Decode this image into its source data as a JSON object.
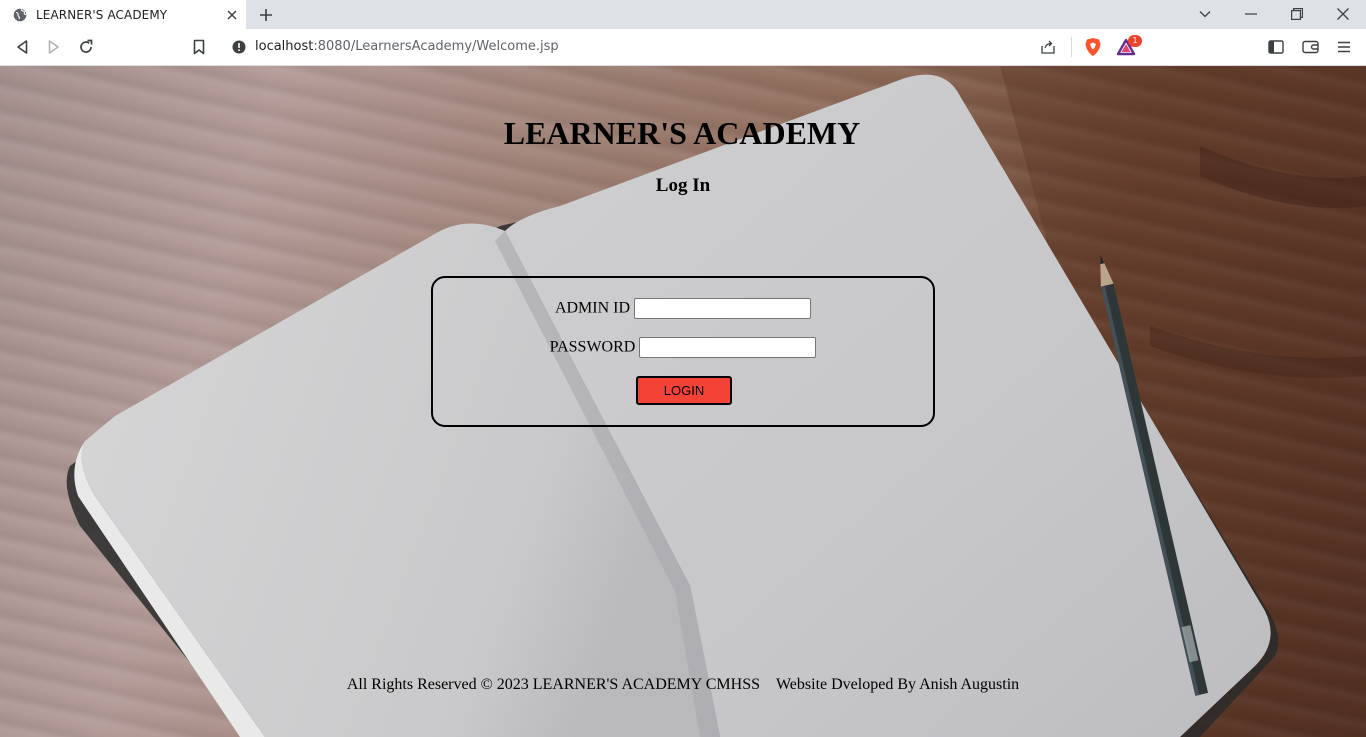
{
  "browser": {
    "tab_title": "LEARNER'S ACADEMY",
    "url_host": "localhost",
    "url_rest": ":8080/LearnersAcademy/Welcome.jsp",
    "notification_count": "1"
  },
  "page": {
    "title": "LEARNER'S ACADEMY",
    "heading": "Log In",
    "form": {
      "admin_id_label": "ADMIN ID",
      "admin_id_value": "",
      "password_label": "PASSWORD",
      "password_value": "",
      "login_button": "LOGIN"
    },
    "footer": {
      "rights": "All Rights Reserved © 2023 LEARNER'S ACADEMY CMHSS",
      "developer": "Website Dveloped By Anish Augustin"
    }
  },
  "colors": {
    "login_button": "#f44336",
    "tab_strip": "#dee1e6"
  }
}
